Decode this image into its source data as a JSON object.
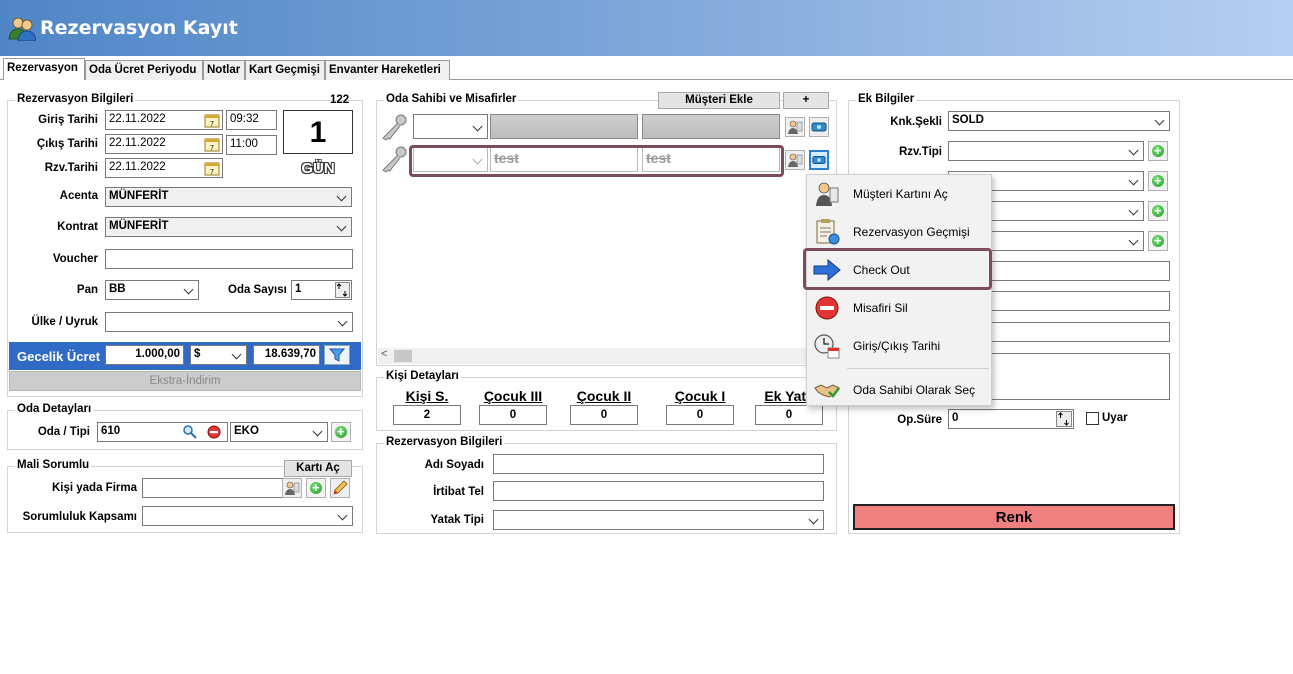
{
  "window": {
    "title": "Rezervasyon Kayıt"
  },
  "tabs": [
    {
      "label": "Rezervasyon"
    },
    {
      "label": "Oda Ücret Periyodu"
    },
    {
      "label": "Notlar"
    },
    {
      "label": "Kart Geçmişi"
    },
    {
      "label": "Envanter Hareketleri"
    }
  ],
  "rezervasyon_bilgileri": {
    "title": "Rezervasyon Bilgileri",
    "number": "122",
    "giris_label": "Giriş Tarihi",
    "giris_date": "22.11.2022",
    "giris_time": "09:32",
    "cikis_label": "Çıkış Tarihi",
    "cikis_date": "22.11.2022",
    "cikis_time": "11:00",
    "rzv_label": "Rzv.Tarihi",
    "rzv_date": "22.11.2022",
    "days": "1",
    "days_unit": "GÜN",
    "acenta_label": "Acenta",
    "acenta_value": "MÜNFERİT",
    "kontrat_label": "Kontrat",
    "kontrat_value": "MÜNFERİT",
    "voucher_label": "Voucher",
    "voucher_value": "",
    "pan_label": "Pan",
    "pan_value": "BB",
    "oda_sayisi_label": "Oda Sayısı",
    "oda_sayisi_value": "1",
    "ulke_label": "Ülke / Uyruk",
    "ulke_value": "",
    "gecelik_label": "Gecelik Ücret",
    "gecelik_value": "1.000,00",
    "currency": "$",
    "converted_value": "18.639,70",
    "ekstra_label": "Ekstra-İndirim"
  },
  "oda_detaylari": {
    "title": "Oda Detayları",
    "oda_label": "Oda / Tipi",
    "oda_value": "610",
    "tip_value": "EKO"
  },
  "mali_sorumlu": {
    "title": "Mali Sorumlu",
    "karti_ac": "Kartı Aç",
    "kisi_label": "Kişi yada Firma",
    "kisi_value": "",
    "kapsam_label": "Sorumluluk Kapsamı",
    "kapsam_value": ""
  },
  "oda_sahibi": {
    "title": "Oda Sahibi ve Misafirler",
    "add_button": "Müşteri Ekle",
    "plus_button": "+",
    "guests": [
      {
        "first": "",
        "last": ""
      },
      {
        "first": "test",
        "last": "test"
      }
    ]
  },
  "kisi_detaylari": {
    "title": "Kişi Detayları",
    "columns": [
      {
        "label": "Kişi S.",
        "value": "2"
      },
      {
        "label": "Çocuk III",
        "value": "0"
      },
      {
        "label": "Çocuk II",
        "value": "0"
      },
      {
        "label": "Çocuk I",
        "value": "0"
      },
      {
        "label": "Ek Yatak",
        "value": "0"
      }
    ]
  },
  "rezervasyon_bilgileri2": {
    "title": "Rezervasyon Bilgileri",
    "adi_label": "Adı Soyadı",
    "adi_value": "",
    "irtibat_label": "İrtibat Tel",
    "irtibat_value": "",
    "yatak_label": "Yatak Tipi",
    "yatak_value": ""
  },
  "ek_bilgiler": {
    "title": "Ek Bilgiler",
    "knk_label": "Knk.Şekli",
    "knk_value": "SOLD",
    "rzv_tipi_label": "Rzv.Tipi",
    "rzv_tipi_value": "",
    "op_sure_label": "Op.Süre",
    "op_sure_value": "0",
    "uyar_label": "Uyar",
    "renk_label": "Renk",
    "renk_color": "#f08080"
  },
  "context_menu": {
    "items": [
      {
        "label": "Müşteri Kartını Aç",
        "icon": "customer-card-icon"
      },
      {
        "label": "Rezervasyon Geçmişi",
        "icon": "history-clipboard-icon"
      },
      {
        "label": "Check Out",
        "icon": "arrow-right-icon"
      },
      {
        "label": "Misafiri Sil",
        "icon": "delete-icon"
      },
      {
        "label": "Giriş/Çıkış Tarihi",
        "icon": "clock-calendar-icon"
      },
      {
        "label": "Oda Sahibi Olarak Seç",
        "icon": "handshake-icon"
      }
    ]
  }
}
